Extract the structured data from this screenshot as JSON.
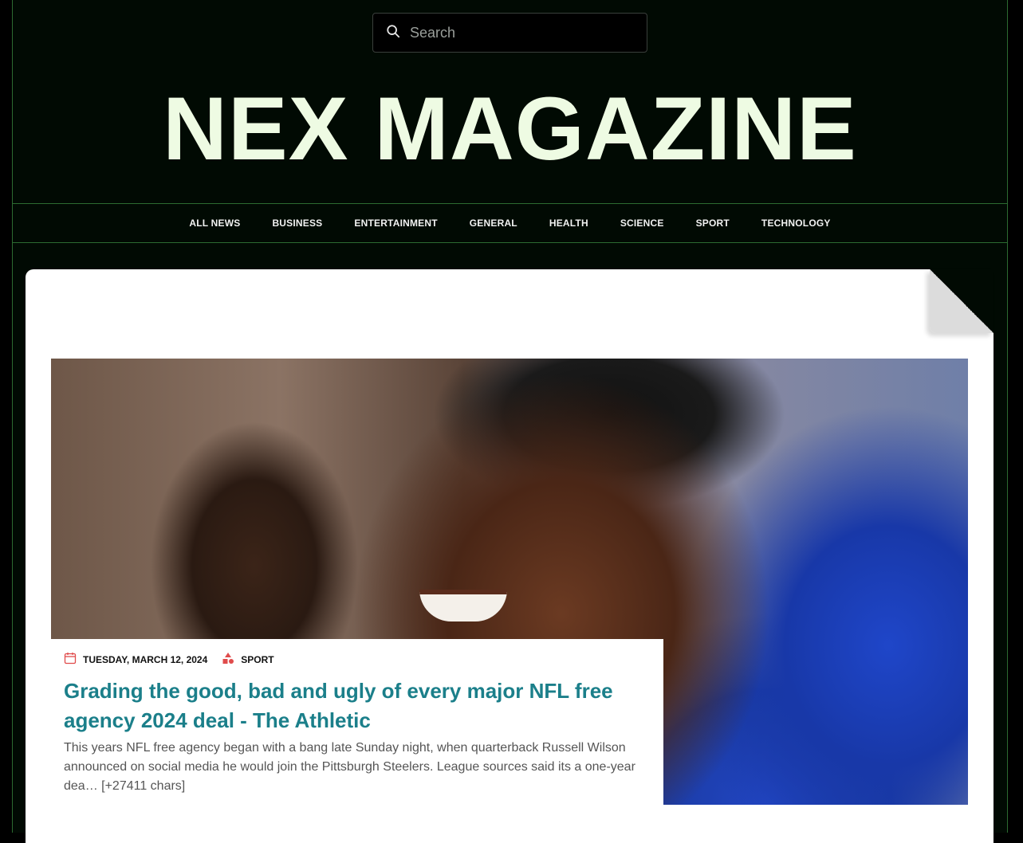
{
  "search": {
    "placeholder": "Search"
  },
  "site": {
    "title": "NEX MAGAZINE"
  },
  "nav": {
    "items": [
      "ALL NEWS",
      "BUSINESS",
      "ENTERTAINMENT",
      "GENERAL",
      "HEALTH",
      "SCIENCE",
      "SPORT",
      "TECHNOLOGY"
    ]
  },
  "article": {
    "date": "TUESDAY, MARCH 12, 2024",
    "category": "SPORT",
    "headline": "Grading the good, bad and ugly of every major NFL free agency 2024 deal - The Athletic",
    "excerpt": "This years NFL free agency began with a bang late Sunday night, when quarterback Russell Wilson announced on social media he would join the Pittsburgh Steelers. League sources said its a one-year dea… [+27411 chars]"
  },
  "icons": {
    "search": "search-icon",
    "date": "calendar-icon",
    "category": "shapes-icon"
  },
  "colors": {
    "background": "#010a03",
    "border": "#2c6b31",
    "title": "#eefbe3",
    "headline": "#1b7f8a",
    "meta_icon": "#e04b4b"
  }
}
